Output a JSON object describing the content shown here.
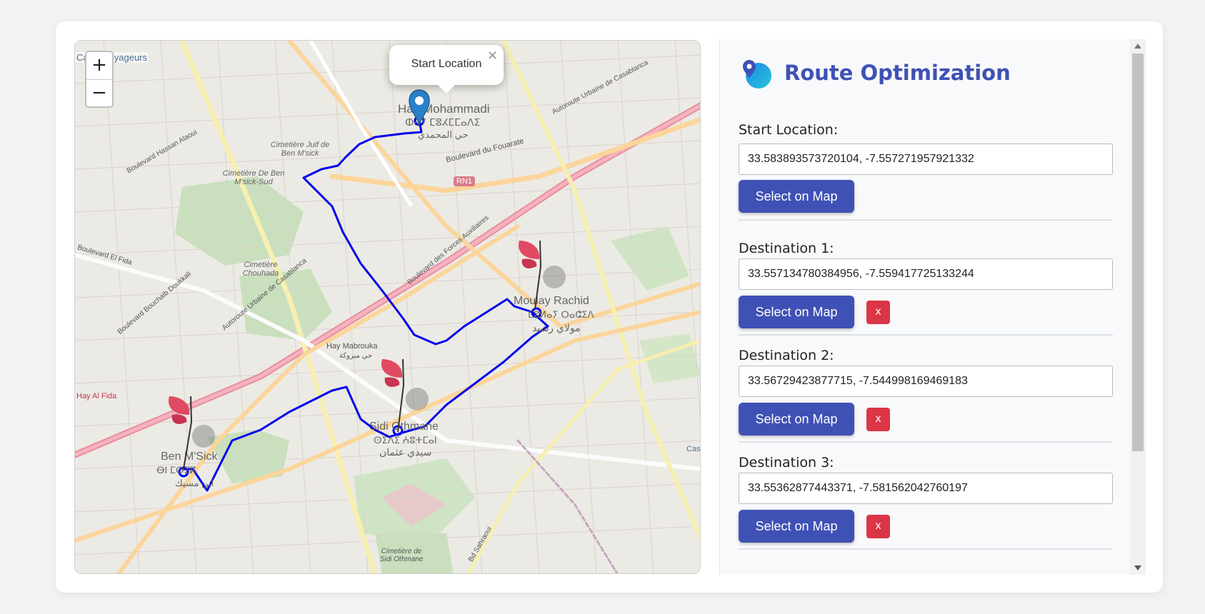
{
  "map": {
    "attribution": "Cas... Voyageurs",
    "zoom_in": "+",
    "zoom_out": "−",
    "popup": {
      "text": "Start Location",
      "close": "×"
    },
    "labels": {
      "hay_mohammadi": "Hay Mohammadi",
      "hay_mohammadi_tif": "ⵀⴰⵢ ⵎⵓⵃⵎⵎⴰⴷⵉ",
      "hay_mohammadi_ar": "حي المحمدي",
      "boulevard_fouarate": "Boulevard du Fouarate",
      "rn1": "RN1",
      "cim_juif": "Cimetière Juif de Ben M'sick",
      "cim_sud": "Cimetière De Ben M'sick-Sud",
      "cim_chouhada": "Cimetière Chouhada",
      "bd_hassan": "Boulevard Hassan Alaoui",
      "bd_fida": "Boulevard El Fida",
      "bd_bouchaib": "Boulevard Bouchaib Doukkali",
      "autoroute_left": "Autoroute Urbaine de Casablanca",
      "autoroute_right": "Autoroute Urbaine de Casablanca",
      "bd_forces": "Boulevard des Forces Auxiliaires",
      "moulay_rachid": "Moulay Rachid",
      "moulay_rachid_tif": "ⵎⵓⵍⴰⵢ ⵔⴰⵛⵉⴷ",
      "moulay_rachid_ar": "مولاي رشيد",
      "hay_mabrouka": "Hay Mabrouka",
      "hay_mabrouka_ar": "حي مبروكة",
      "sidi_othmane": "Sidi Othmane",
      "sidi_othmane_tif": "ⵙⵉⴷⵉ ⵄⵓⵜⵎⴰⵏ",
      "sidi_othmane_ar": "سيدي عثمان",
      "ben_msick": "Ben M'Sick",
      "ben_msick_tif": "ⴱⵏ ⵎⵙⵉⴽ",
      "ben_msick_ar": "ابن مسيك",
      "hay_al_fida": "Hay Al Fida",
      "cim_sidi_othmane": "Cimetière de Sidi Othmane",
      "bd_sahraoui": "Bd Sahraoui",
      "cas_right": "Cas"
    }
  },
  "panel": {
    "title": "Route Optimization",
    "start": {
      "label": "Start Location:",
      "value": "33.583893573720104, -7.557271957921332",
      "button": "Select on Map"
    },
    "destinations": [
      {
        "label": "Destination 1:",
        "value": "33.557134780384956, -7.559417725133244",
        "button": "Select on Map",
        "remove": "x"
      },
      {
        "label": "Destination 2:",
        "value": "33.56729423877715, -7.544998169469183",
        "button": "Select on Map",
        "remove": "x"
      },
      {
        "label": "Destination 3:",
        "value": "33.55362877443371, -7.581562042760197",
        "button": "Select on Map",
        "remove": "x"
      }
    ]
  },
  "colors": {
    "accent": "#3f51b5",
    "danger": "#dc3545",
    "route": "#0000ee",
    "marker": "#2a81cb",
    "pin": "#e04a62"
  },
  "icons": [
    "zoom-in-icon",
    "zoom-out-icon",
    "close-icon",
    "map-marker-icon",
    "pin-icon",
    "route-logo-icon",
    "scroll-up-icon",
    "scroll-down-icon"
  ]
}
